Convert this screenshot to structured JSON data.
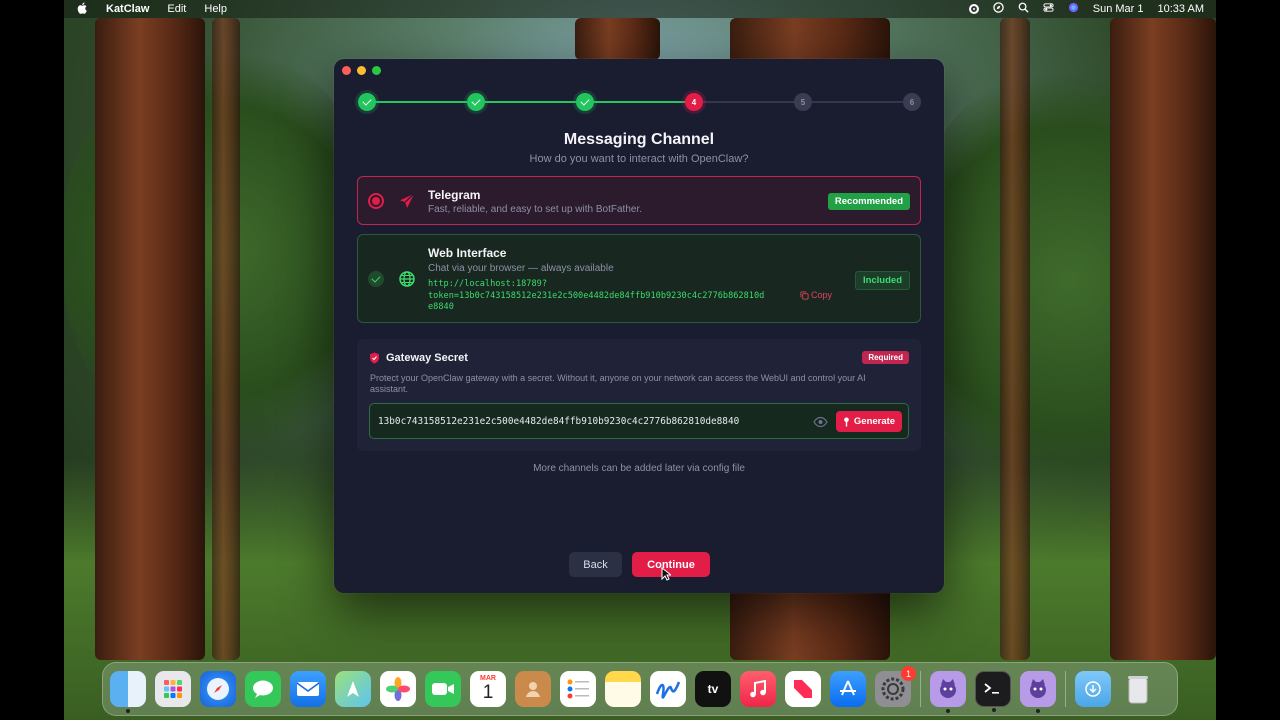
{
  "menubar": {
    "apple": "",
    "app_name": "KatClaw",
    "items": [
      "Edit",
      "Help"
    ],
    "date": "Sun Mar 1",
    "time": "10:33 AM"
  },
  "stepper": {
    "steps": [
      {
        "state": "done",
        "label": ""
      },
      {
        "state": "done",
        "label": ""
      },
      {
        "state": "done",
        "label": ""
      },
      {
        "state": "current",
        "label": "4"
      },
      {
        "state": "todo",
        "label": "5"
      },
      {
        "state": "todo",
        "label": "6"
      }
    ],
    "accent_done": "#22c55e",
    "accent_current": "#e11d48"
  },
  "page": {
    "title": "Messaging Channel",
    "subtitle": "How do you want to interact with OpenClaw?"
  },
  "telegram": {
    "title": "Telegram",
    "desc": "Fast, reliable, and easy to set up with BotFather.",
    "badge": "Recommended",
    "icon": "send-icon"
  },
  "web": {
    "title": "Web Interface",
    "desc": "Chat via your browser — always available",
    "url_line1": "http://localhost:18789?",
    "url_line2": "token=13b0c743158512e231e2c500e4482de84ffb910b9230c4c2776b862810d",
    "url_line3": "e8840",
    "copy_label": "Copy",
    "badge": "Included",
    "icon": "globe-icon"
  },
  "gateway": {
    "title": "Gateway Secret",
    "badge": "Required",
    "desc": "Protect your OpenClaw gateway with a secret. Without it, anyone on your network can access the WebUI and control your AI assistant.",
    "secret": "13b0c743158512e231e2c500e4482de84ffb910b9230c4c2776b862810de8840",
    "generate_label": "Generate"
  },
  "note": "More channels can be added later via config file",
  "buttons": {
    "back": "Back",
    "continue": "Continue"
  },
  "dock": {
    "calendar_month": "MAR",
    "calendar_day": "1",
    "settings_badge": "1",
    "tv_label": "tv"
  }
}
